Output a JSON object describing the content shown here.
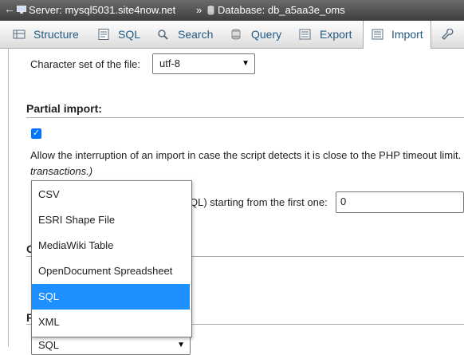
{
  "breadcrumb": {
    "back_glyph": "←",
    "server": "Server: mysql5031.site4now.net",
    "separator": "»",
    "database": "Database: db_a5aa3e_oms"
  },
  "tabs": [
    {
      "label": "Structure",
      "icon": "structure-icon"
    },
    {
      "label": "SQL",
      "icon": "sql-icon"
    },
    {
      "label": "Search",
      "icon": "search-icon"
    },
    {
      "label": "Query",
      "icon": "query-icon"
    },
    {
      "label": "Export",
      "icon": "export-icon"
    },
    {
      "label": "Import",
      "icon": "import-icon",
      "active": true
    },
    {
      "label": "",
      "icon": "wrench-icon"
    }
  ],
  "charset": {
    "label": "Character set of the file:",
    "value": "utf-8"
  },
  "partial_import": {
    "title": "Partial import:",
    "checked": true,
    "allow_text": "Allow the interruption of an import in case the script detects it is close to the PHP timeout limit.",
    "transactions_text": "transactions.)",
    "skip_text": "QL) starting from the first one:",
    "skip_value": "0"
  },
  "partial_letters": {
    "o": "O",
    "f": "F"
  },
  "format": {
    "options": [
      "CSV",
      "ESRI Shape File",
      "MediaWiki Table",
      "OpenDocument Spreadsheet",
      "SQL",
      "XML"
    ],
    "selected": "SQL",
    "select_value": "SQL"
  },
  "colors": {
    "accent": "#1e8fff",
    "link": "#235a81",
    "topbar": "#4a4a4a"
  }
}
